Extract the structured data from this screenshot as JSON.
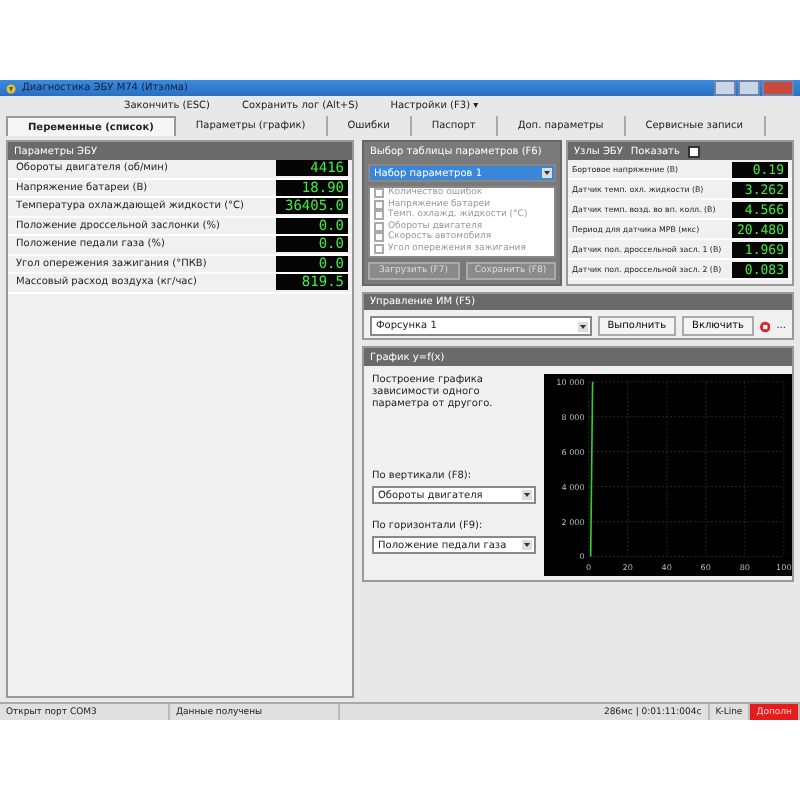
{
  "window": {
    "title": "Диагностика ЭБУ М74 (Итэлма)"
  },
  "menu": [
    {
      "label": "Закончить (ESC)"
    },
    {
      "label": "Сохранить лог (Alt+S)"
    },
    {
      "label": "Настройки (F3) ▾"
    }
  ],
  "tabs": [
    {
      "label": "Переменные (список)",
      "selected": true
    },
    {
      "label": "Параметры (график)",
      "selected": false
    },
    {
      "label": "Ошибки",
      "selected": false
    },
    {
      "label": "Паспорт",
      "selected": false
    },
    {
      "label": "Доп. параметры",
      "selected": false
    },
    {
      "label": "Сервисные записи",
      "selected": false
    }
  ],
  "ecu_params": {
    "title": "Параметры ЭБУ",
    "rows": [
      {
        "name": "Обороты двигателя (об/мин)",
        "value": "4416"
      },
      {
        "name": "Напряжение батареи (В)",
        "value": "18.90"
      },
      {
        "name": "Температура охлаждающей жидкости (°С)",
        "value": "36405.0"
      },
      {
        "name": "Положение дроссельной заслонки (%)",
        "value": "0.0"
      },
      {
        "name": "Положение педали газа (%)",
        "value": "0.0"
      },
      {
        "name": "Угол опережения зажигания (°ПКВ)",
        "value": "0.0"
      },
      {
        "name": "Массовый расход воздуха (кг/час)",
        "value": "819.5"
      }
    ]
  },
  "param_table": {
    "title": "Выбор таблицы параметров (F6)",
    "selected_set": "Набор параметров 1",
    "items": [
      {
        "label": "Количество ошибок",
        "checked": false
      },
      {
        "label": "Напряжение батареи",
        "checked": false
      },
      {
        "label": "Темп. охлажд. жидкости (°С)",
        "checked": false
      },
      {
        "label": "Обороты двигателя",
        "checked": false
      },
      {
        "label": "Скорость автомобиля",
        "checked": false
      },
      {
        "label": "Угол опережения зажигания",
        "checked": false
      }
    ],
    "buttons": [
      {
        "label": "Загрузить (F7)",
        "disabled": true
      },
      {
        "label": "Сохранить (F8)",
        "disabled": true
      }
    ]
  },
  "sensors": {
    "title": "Узлы ЭБУ",
    "toggle_label": "Показать",
    "toggle_checked": false,
    "rows": [
      {
        "name": "Бортовое напряжение (В)",
        "value": "0.19"
      },
      {
        "name": "Датчик темп. охл. жидкости (В)",
        "value": "3.262"
      },
      {
        "name": "Датчик темп. возд. во вп. колл. (В)",
        "value": "4.566"
      },
      {
        "name": "Период для датчика МРВ (мкс)",
        "value": "20.480"
      },
      {
        "name": "Датчик пол. дроссельной засл. 1 (В)",
        "value": "1.969"
      },
      {
        "name": "Датчик пол. дроссельной засл. 2 (В)",
        "value": "0.083"
      }
    ]
  },
  "actuators": {
    "title": "Управление ИМ (F5)",
    "selected": "Форсунка 1",
    "buttons": [
      {
        "label": "Выполнить"
      },
      {
        "label": "Включить"
      }
    ],
    "more": "..."
  },
  "graph": {
    "title": "График y=f(x)",
    "description": "Построение графика зависимости одного параметра от другого.",
    "vertical_label": "По вертикали (F8):",
    "vertical_value": "Обороты двигателя",
    "horizontal_label": "По горизонтали (F9):",
    "horizontal_value": "Положение педали газа",
    "chart_data": {
      "type": "line",
      "grid": true,
      "x": [
        1,
        2
      ],
      "series": [
        {
          "color": "#33cc33",
          "values": [
            0,
            10000
          ]
        }
      ],
      "xlim": [
        0,
        100
      ],
      "ylim": [
        0,
        10000
      ],
      "xticks": [
        0,
        20,
        40,
        60,
        80,
        100
      ],
      "yticks": [
        {
          "value": 0,
          "label": "0"
        },
        {
          "value": 2000,
          "label": "2 000"
        },
        {
          "value": 4000,
          "label": "4 000"
        },
        {
          "value": 6000,
          "label": "6 000"
        },
        {
          "value": 8000,
          "label": "8 000"
        },
        {
          "value": 10000,
          "label": "10 000"
        }
      ]
    }
  },
  "status_bar": [
    {
      "text": "Открыт порт COM3",
      "kind": "plain"
    },
    {
      "text": "Данные получены",
      "kind": "plain"
    },
    {
      "text": "286мс | 0:01:11:004с",
      "kind": "plain"
    },
    {
      "text": "K-Line",
      "kind": "plain"
    },
    {
      "text": "Дополн",
      "kind": "alert"
    }
  ]
}
